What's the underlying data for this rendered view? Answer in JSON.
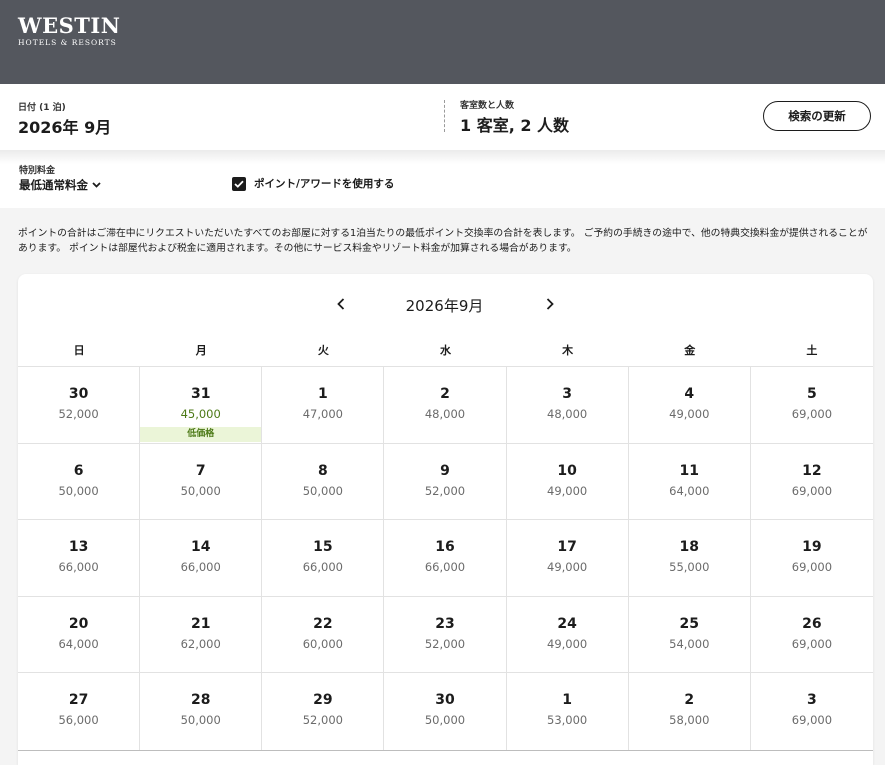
{
  "brand": {
    "name": "WESTIN",
    "tagline": "HOTELS & RESORTS"
  },
  "search": {
    "date_label": "日付 (1 泊)",
    "date_value": "2026年 9月",
    "guests_label": "客室数と人数",
    "guests_value": "1 客室, 2 人数",
    "update_button": "検索の更新"
  },
  "filters": {
    "rate_label": "特別料金",
    "rate_value": "最低通常料金",
    "points_label": "ポイント/アワードを使用する",
    "points_checked": true
  },
  "disclaimer": "ポイントの合計はご滞在中にリクエストいただいたすべてのお部屋に対する1泊当たりの最低ポイント交換率の合計を表します。 ご予約の手続きの途中で、他の特典交換料金が提供されることがあります。 ポイントは部屋代および税金に適用されます。その他にサービス料金やリゾート料金が加算される場合があります。",
  "calendar": {
    "month_title": "2026年9月",
    "weekdays": [
      "日",
      "月",
      "火",
      "水",
      "木",
      "金",
      "土"
    ],
    "low_price_label": "低価格",
    "days": [
      {
        "day": "30",
        "price": "52,000"
      },
      {
        "day": "31",
        "price": "45,000",
        "low": true
      },
      {
        "day": "1",
        "price": "47,000"
      },
      {
        "day": "2",
        "price": "48,000"
      },
      {
        "day": "3",
        "price": "48,000"
      },
      {
        "day": "4",
        "price": "49,000"
      },
      {
        "day": "5",
        "price": "69,000"
      },
      {
        "day": "6",
        "price": "50,000"
      },
      {
        "day": "7",
        "price": "50,000"
      },
      {
        "day": "8",
        "price": "50,000"
      },
      {
        "day": "9",
        "price": "52,000"
      },
      {
        "day": "10",
        "price": "49,000"
      },
      {
        "day": "11",
        "price": "64,000"
      },
      {
        "day": "12",
        "price": "69,000"
      },
      {
        "day": "13",
        "price": "66,000"
      },
      {
        "day": "14",
        "price": "66,000"
      },
      {
        "day": "15",
        "price": "66,000"
      },
      {
        "day": "16",
        "price": "66,000"
      },
      {
        "day": "17",
        "price": "49,000"
      },
      {
        "day": "18",
        "price": "55,000"
      },
      {
        "day": "19",
        "price": "69,000"
      },
      {
        "day": "20",
        "price": "64,000"
      },
      {
        "day": "21",
        "price": "62,000"
      },
      {
        "day": "22",
        "price": "60,000"
      },
      {
        "day": "23",
        "price": "52,000"
      },
      {
        "day": "24",
        "price": "49,000"
      },
      {
        "day": "25",
        "price": "54,000"
      },
      {
        "day": "26",
        "price": "69,000"
      },
      {
        "day": "27",
        "price": "56,000"
      },
      {
        "day": "28",
        "price": "50,000"
      },
      {
        "day": "29",
        "price": "52,000"
      },
      {
        "day": "30",
        "price": "50,000"
      },
      {
        "day": "1",
        "price": "53,000"
      },
      {
        "day": "2",
        "price": "58,000"
      },
      {
        "day": "3",
        "price": "69,000"
      }
    ]
  },
  "colors": {
    "header_bg": "#54575e",
    "low_price_text": "#4d7a18",
    "low_price_bg": "#ebf5d8"
  }
}
